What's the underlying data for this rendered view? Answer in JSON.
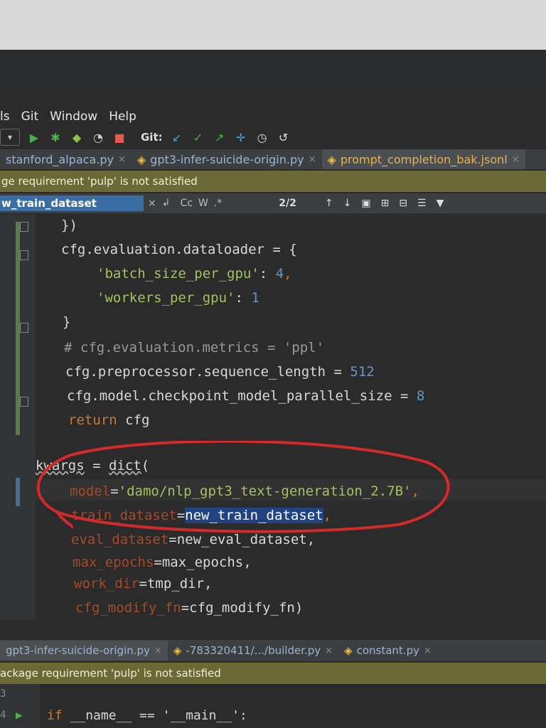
{
  "menu": [
    "ls",
    "Git",
    "Window",
    "Help"
  ],
  "toolbar": {
    "git_label": "Git:",
    "icons": [
      "dropdown-icon",
      "run-icon",
      "debug-icon",
      "coverage-icon",
      "profile-icon",
      "stop-icon",
      "git-update-icon",
      "git-commit-icon",
      "git-push-icon",
      "git-merge-icon",
      "history-icon",
      "rollback-icon"
    ]
  },
  "tabs": [
    {
      "label": "stanford_alpaca.py",
      "close": "×",
      "active": false
    },
    {
      "label": "gpt3-infer-suicide-origin.py",
      "close": "×",
      "active": false
    },
    {
      "label": "prompt_completion_bak.jsonl",
      "close": "×",
      "active": true
    }
  ],
  "banner": {
    "text": "ge requirement 'pulp' is not satisfied"
  },
  "find": {
    "query": "w_train_dataset",
    "clear": "×",
    "cc": "Cc",
    "w": "W",
    "regex": ".*",
    "count": "2/2"
  },
  "code": {
    "l1": "})",
    "l2a": "cfg.evaluation.dataloader = {",
    "l3_key": "'batch_size_per_gpu'",
    "l3_sep": ": ",
    "l3_val": "4",
    "l3_end": ",",
    "l4_key": "'workers_per_gpu'",
    "l4_sep": ": ",
    "l4_val": "1",
    "l5": "}",
    "l6": "# cfg.evaluation.metrics = 'ppl'",
    "l7a": "cfg.preprocessor.sequence_length = ",
    "l7b": "512",
    "l8a": "cfg.model.checkpoint_model_parallel_size = ",
    "l8b": "8",
    "l9a": "return",
    "l9b": " cfg",
    "l10a": "kwargs",
    "l10b": " = ",
    "l10c": "dict",
    "l10d": "(",
    "l11_param": "model",
    "l11_eq": "=",
    "l11_val": "'damo/nlp_gpt3_text-generation_2.7B'",
    "l11_end": ",",
    "l12_param": "train_dataset",
    "l12_eq": "=",
    "l12_val": "new_train_dataset",
    "l12_end": ",",
    "l13_param": "eval_dataset",
    "l13_rest": "=new_eval_dataset,",
    "l14_param": "max_epochs",
    "l14_rest": "=max_epochs,",
    "l15_param": "work_dir",
    "l15_rest": "=tmp_dir,",
    "l16_param": "cfg_modify_fn",
    "l16_rest": "=cfg_modify_fn)"
  },
  "bottom": {
    "tabs": [
      {
        "label": "gpt3-infer-suicide-origin.py",
        "close": "×"
      },
      {
        "label": "-783320411/.../builder.py",
        "close": "×"
      },
      {
        "label": "constant.py",
        "close": "×"
      }
    ],
    "banner": "ackage requirement 'pulp' is not satisfied",
    "line_no_1": "3",
    "line_no_2": "4",
    "code_kw": "if",
    "code_rest": " __name__ == '__main__':"
  }
}
